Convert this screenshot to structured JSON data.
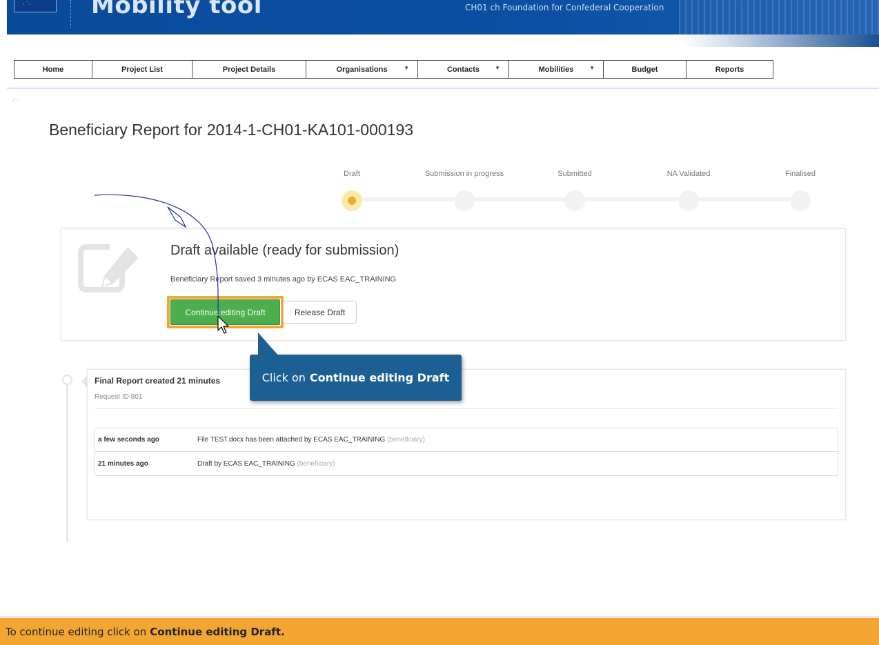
{
  "banner": {
    "app_title": "Mobility tool",
    "organisation": "CH01 ch Foundation for Confederal Cooperation"
  },
  "nav": {
    "items": [
      {
        "label": "Home",
        "dropdown": false
      },
      {
        "label": "Project List",
        "dropdown": false
      },
      {
        "label": "Project Details",
        "dropdown": false
      },
      {
        "label": "Organisations",
        "dropdown": true
      },
      {
        "label": "Contacts",
        "dropdown": true
      },
      {
        "label": "Mobilities",
        "dropdown": true
      },
      {
        "label": "Budget",
        "dropdown": false
      },
      {
        "label": "Reports",
        "dropdown": false
      }
    ]
  },
  "page": {
    "title": "Beneficiary Report for 2014-1-CH01-KA101-000193"
  },
  "stepper": {
    "steps": [
      {
        "label": "Draft",
        "active": true
      },
      {
        "label": "Submission in progress",
        "active": false
      },
      {
        "label": "Submitted",
        "active": false
      },
      {
        "label": "NA Validated",
        "active": false
      },
      {
        "label": "Finalised",
        "active": false
      }
    ]
  },
  "draft": {
    "icon": "edit-icon",
    "title": "Draft available (ready for submission)",
    "subtitle": "Beneficiary Report saved 3 minutes ago by ECAS EAC_TRAINING",
    "continue_label": "Continue editing Draft",
    "release_label": "Release Draft"
  },
  "history": {
    "title": "Final Report created 21 minutes",
    "request_id": "Request ID 801",
    "rows": [
      {
        "when": "a few seconds ago",
        "what": "File TEST.docx has been attached by ECAS EAC_TRAINING",
        "role": "(beneficiary)"
      },
      {
        "when": "21 minutes ago",
        "what": "Draft by ECAS EAC_TRAINING",
        "role": "(beneficiary)"
      }
    ]
  },
  "callout": {
    "prefix": "Click on",
    "target": "Continue editing Draft"
  },
  "instruction": {
    "prefix": "To continue editing click on",
    "target": "Continue editing Draft."
  },
  "colors": {
    "banner_blue": "#0a4fa3",
    "active_step": "#f0a92a",
    "continue_green": "#4cae4c",
    "highlight_orange": "#f2a734",
    "callout_blue": "#1b5f93",
    "instruction_bar": "#f3a632"
  }
}
